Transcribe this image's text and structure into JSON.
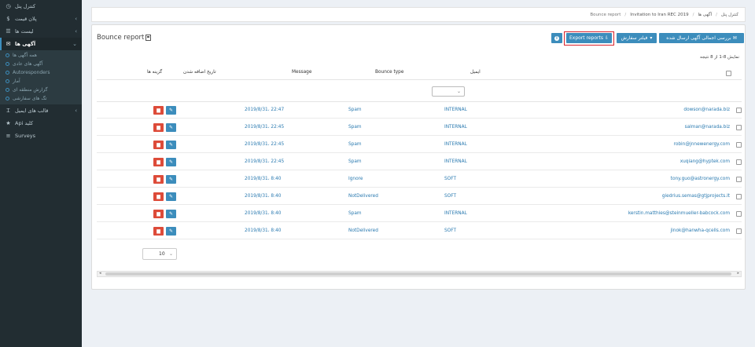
{
  "sidebar": {
    "items": [
      {
        "label": "کنترل پنل",
        "icon": "dashboard-icon"
      },
      {
        "label": "پلان قیمت",
        "icon": "dollar-icon"
      },
      {
        "label": "لیست ها",
        "icon": "list-icon"
      },
      {
        "label": "آگهی ها",
        "icon": "envelope-icon"
      },
      {
        "label": "قالب های ایمیل",
        "icon": "text-icon"
      },
      {
        "label": "Api کلید",
        "icon": "star-icon"
      },
      {
        "label": "Surveys",
        "icon": "bars-icon"
      }
    ],
    "subitems": [
      "همه آگهی ها",
      "آگهی های عادی",
      "Autoresponders",
      "آمار",
      "گزارش منطقه ای",
      "تگ های سفارشی"
    ]
  },
  "breadcrumb": {
    "items": [
      "کنترل پنل",
      "آگهی ها",
      "Invitation to Iran REC 2019",
      "Bounce report"
    ],
    "separator": "/"
  },
  "box": {
    "title": "Bounce report",
    "buttons": {
      "review": "بررسی اجمالی آگهی ارسال شده",
      "filter": "فیلتر سفارش",
      "export": "Export reports",
      "info": "i"
    },
    "count_text": "نمایش 8-1 از 8 نتیجه"
  },
  "table": {
    "headers": {
      "email": "ایمیل",
      "bounce_type": "Bounce type",
      "message": "Message",
      "date_added": "تاریخ اضافه شدن",
      "options": "گزینه ها"
    },
    "rows": [
      {
        "email": "dowson@narada.biz",
        "type": "INTERNAL",
        "message": "Spam",
        "date": "2019/8/31، 22:47"
      },
      {
        "email": "salman@narada.biz",
        "type": "INTERNAL",
        "message": "Spam",
        "date": "2019/8/31، 22:45"
      },
      {
        "email": "robin@jnnewenergy.com",
        "type": "INTERNAL",
        "message": "Spam",
        "date": "2019/8/31، 22:45"
      },
      {
        "email": "xuqiang@hyptek.com",
        "type": "INTERNAL",
        "message": "Spam",
        "date": "2019/8/31، 22:45"
      },
      {
        "email": "tony.guo@astronergy.com",
        "type": "SOFT",
        "message": "Ignore",
        "date": "2019/8/31، 8:40"
      },
      {
        "email": "giedrius.semas@gtjprojects.lt",
        "type": "SOFT",
        "message": "NotDelivered",
        "date": "2019/8/31، 8:40"
      },
      {
        "email": "kerstin.matthies@steinmueller-babcock.com",
        "type": "INTERNAL",
        "message": "Spam",
        "date": "2019/8/31، 8:40"
      },
      {
        "email": "jinok@hanwha-qcells.com",
        "type": "SOFT",
        "message": "NotDelivered",
        "date": "2019/8/31، 8:40"
      }
    ]
  },
  "pagination": {
    "page_size": "10"
  }
}
